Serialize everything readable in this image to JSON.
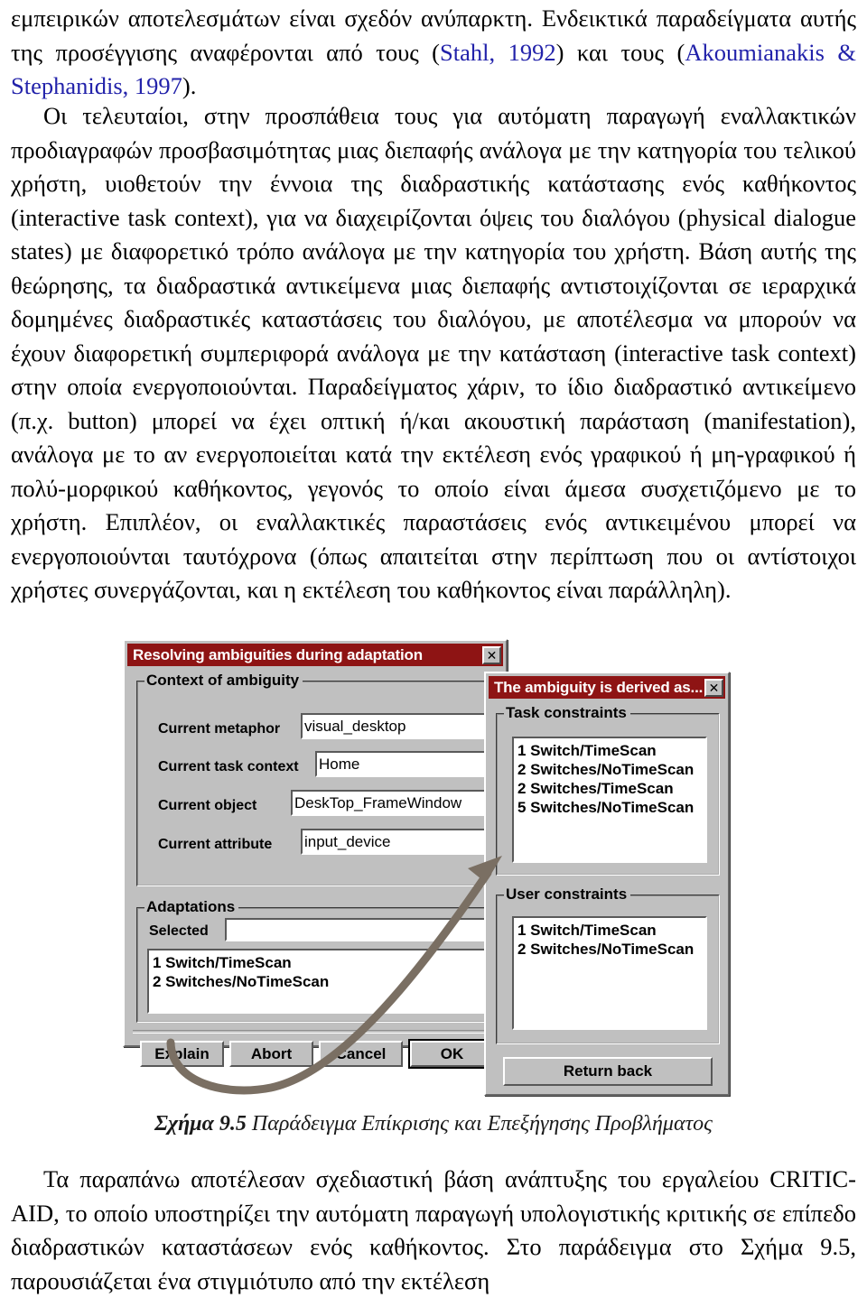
{
  "document": {
    "paragraph_top": "εμπειρικών αποτελεσμάτων είναι σχεδόν ανύπαρκτη. Ενδεικτικά παραδείγματα αυτής της προσέγγισης αναφέρονται από τους (",
    "paragraph_top_ref1": "Stahl, 1992",
    "paragraph_top_mid": ") και τους (",
    "paragraph_top_ref2": "Akoumianakis & Stephanidis, 1997",
    "paragraph_top_end": ").",
    "paragraph_main": "Οι τελευταίοι, στην προσπάθεια τους για αυτόματη παραγωγή εναλλακτικών προδιαγραφών προσβασιμότητας μιας διεπαφής ανάλογα με την κατηγορία του τελικού χρήστη, υιοθετούν την έννοια της διαδραστικής κατάστασης ενός καθήκοντος (interactive task context), για να διαχειρίζονται όψεις του διαλόγου (physical dialogue states) με διαφορετικό τρόπο ανάλογα με την κατηγορία του χρήστη. Βάση αυτής της θεώρησης, τα διαδραστικά αντικείμενα μιας διεπαφής αντιστοιχίζονται σε ιεραρχικά δομημένες διαδραστικές καταστάσεις του διαλόγου, με αποτέλεσμα να μπορούν να έχουν διαφορετική συμπεριφορά ανάλογα με την κατάσταση (interactive task context) στην οποία ενεργοποιούνται. Παραδείγματος χάριν, το ίδιο διαδραστικό αντικείμενο (π.χ. button) μπορεί να έχει οπτική ή/και ακουστική παράσταση (manifestation), ανάλογα με το αν ενεργοποιείται κατά την εκτέλεση ενός γραφικού ή μη-γραφικού ή πολύ-μορφικού καθήκοντος, γεγονός το οποίο είναι άμεσα συσχετιζόμενο με το χρήστη. Επιπλέον, οι εναλλακτικές παραστάσεις ενός αντικειμένου μπορεί να ενεργοποιούνται ταυτόχρονα (όπως απαιτείται στην περίπτωση που οι αντίστοιχοι χρήστες συνεργάζονται, και η εκτέλεση του καθήκοντος είναι παράλληλη).",
    "paragraph_bottom": "Τα παραπάνω αποτέλεσαν σχεδιαστική βάση ανάπτυξης του εργαλείου CRITIC-AID, το οποίο υποστηρίζει την αυτόματη παραγωγή υπολογιστικής κριτικής σε επίπεδο διαδραστικών καταστάσεων ενός καθήκοντος. Στο παράδειγμα στο Σχήμα 9.5, παρουσιάζεται ένα στιγμιότυπο από την εκτέλεση",
    "figure_caption_label": "Σχήμα 9.5",
    "figure_caption_text": " Παράδειγμα Επίκρισης και Επεξήγησης Προβλήματος"
  },
  "colors": {
    "titlebar": "#8e1414",
    "window_face": "#c0c0c0",
    "field_bg": "#ffffff",
    "reference_link": "#2222aa",
    "arrow": "#7a6f63"
  },
  "dialog_resolve": {
    "title": "Resolving ambiguities during adaptation",
    "close_label": "✕",
    "group_context_label": "Context of ambiguity",
    "fields": [
      {
        "label": "Current metaphor",
        "value": "visual_desktop"
      },
      {
        "label": "Current task context",
        "value": "Home"
      },
      {
        "label": "Current object",
        "value": "DeskTop_FrameWindow"
      },
      {
        "label": "Current attribute",
        "value": "input_device"
      }
    ],
    "group_adaptations_label": "Adaptations",
    "selected_label": "Selected",
    "selected_value": "",
    "adaptation_items": [
      "1 Switch/TimeScan",
      "2 Switches/NoTimeScan"
    ],
    "buttons": [
      {
        "label": "Explain",
        "default": false
      },
      {
        "label": "Abort",
        "default": false
      },
      {
        "label": "Cancel",
        "default": false
      },
      {
        "label": "OK",
        "default": true
      }
    ]
  },
  "dialog_derived": {
    "title": "The ambiguity is derived as...",
    "close_label": "✕",
    "group_task_label": "Task constraints",
    "task_items": [
      "1 Switch/TimeScan",
      "2 Switches/NoTimeScan",
      "2 Switches/TimeScan",
      "5 Switches/NoTimeScan"
    ],
    "group_user_label": "User constraints",
    "user_items": [
      "1 Switch/TimeScan",
      "2 Switches/NoTimeScan"
    ],
    "return_button_label": "Return back"
  }
}
